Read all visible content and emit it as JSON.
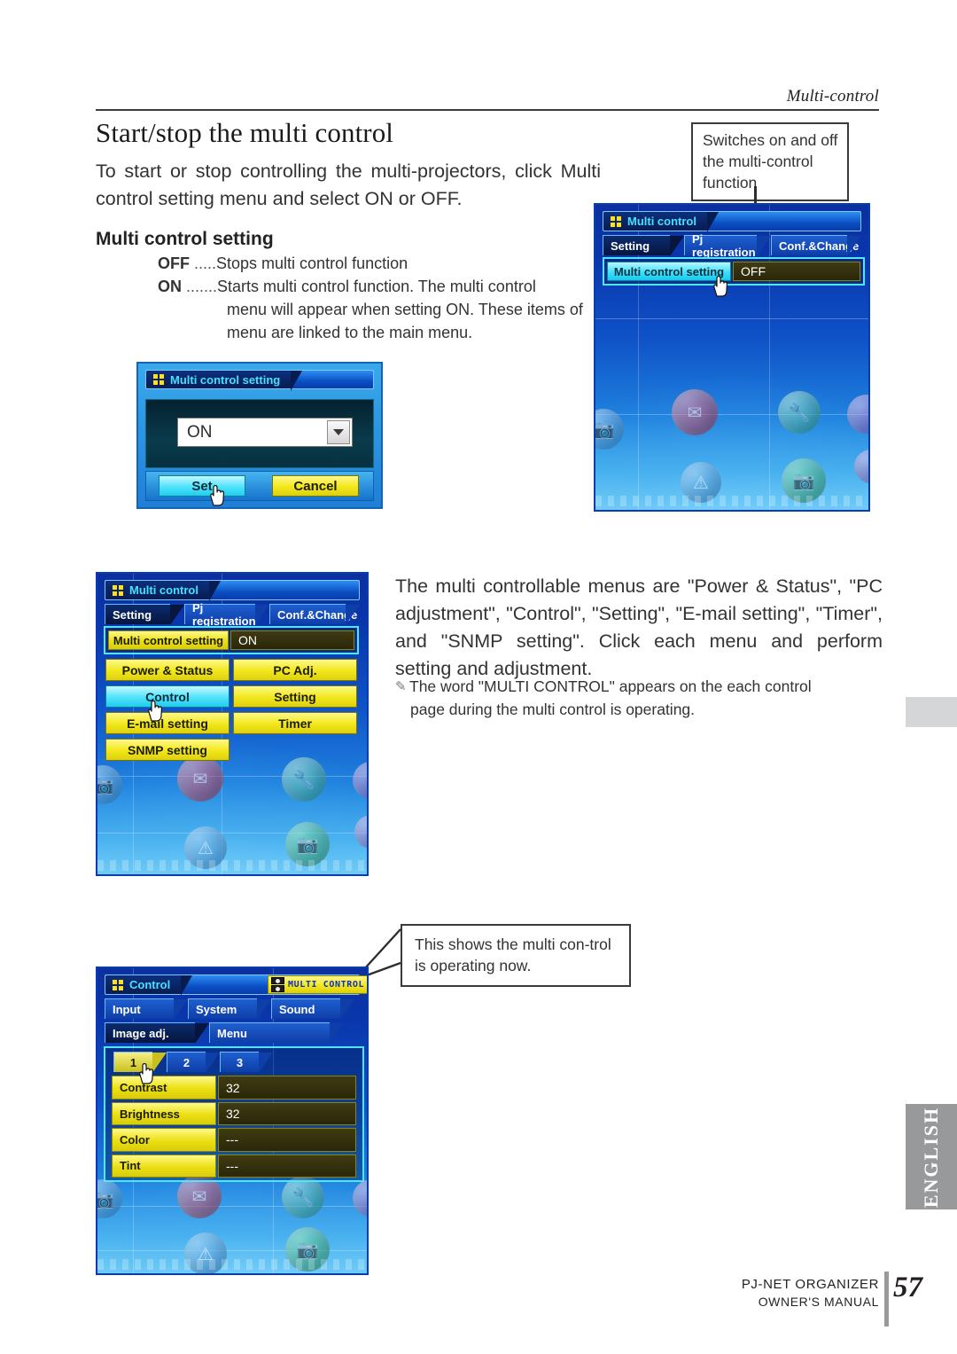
{
  "header": {
    "running_head": "Multi-control"
  },
  "section": {
    "title": "Start/stop the multi control",
    "lead": "To start or stop controlling the multi-projectors, click Multi control setting menu and select ON or OFF.",
    "subheading": "Multi control setting",
    "definitions": [
      {
        "term": "OFF",
        "dots": " .....",
        "desc": "Stops multi control function",
        "cont": ""
      },
      {
        "term": "ON",
        "dots": " .......",
        "desc": "Starts multi control function. The multi control",
        "cont": "menu will appear when setting ON. These items of menu are linked to the main menu."
      }
    ],
    "paragraph": "The multi controllable menus are \"Power & Status\", \"PC adjustment\", \"Control\", \"Setting\", \"E-mail setting\", \"Timer\", and \"SNMP setting\". Click each menu and perform setting and adjustment.",
    "note_icon": "pencil-icon",
    "note_line1": "The word \"MULTI CONTROL\" appears on the each control",
    "note_line2": "page during the multi control is operating."
  },
  "callouts": {
    "top": "Switches on and off the multi-control function",
    "bottom": "This shows the multi con-trol is operating now."
  },
  "screenshot_multicontrol_off": {
    "window_title": "Multi control",
    "tabs": [
      {
        "label": "Setting",
        "state": "active"
      },
      {
        "label": "Pj registration",
        "state": "inactive"
      },
      {
        "label": "Conf.&Change",
        "state": "inactive"
      }
    ],
    "setting_row": {
      "label": "Multi control setting",
      "value": "OFF"
    },
    "cursor": "hand-cursor"
  },
  "dialog_multicontrol_setting": {
    "window_title": "Multi control setting",
    "combo_value": "ON",
    "combo_icon": "chevron-down-icon",
    "set_label": "Set",
    "cancel_label": "Cancel",
    "cursor": "hand-cursor"
  },
  "screenshot_multicontrol_on": {
    "window_title": "Multi control",
    "tabs": [
      {
        "label": "Setting",
        "state": "active"
      },
      {
        "label": "Pj registration",
        "state": "inactive"
      },
      {
        "label": "Conf.&Change",
        "state": "inactive"
      }
    ],
    "setting_row": {
      "label": "Multi control setting",
      "value": "ON"
    },
    "menu_buttons": [
      {
        "label": "Power & Status",
        "state": "normal"
      },
      {
        "label": "PC Adj.",
        "state": "normal"
      },
      {
        "label": "Control",
        "state": "selected"
      },
      {
        "label": "Setting",
        "state": "normal"
      },
      {
        "label": "E-mail setting",
        "state": "normal"
      },
      {
        "label": "Timer",
        "state": "normal"
      },
      {
        "label": "SNMP setting",
        "state": "normal"
      }
    ],
    "cursor": "hand-cursor"
  },
  "screenshot_control": {
    "window_title": "Control",
    "badge_label": "MULTI CONTROL",
    "badge_icon": "projector-icon",
    "tabs_row1": [
      {
        "label": "Input",
        "state": "inactive"
      },
      {
        "label": "System",
        "state": "inactive"
      },
      {
        "label": "Sound",
        "state": "inactive"
      }
    ],
    "tabs_row2": [
      {
        "label": "Image adj.",
        "state": "active"
      },
      {
        "label": "Menu",
        "state": "inactive"
      }
    ],
    "page_tabs": [
      {
        "label": "1",
        "state": "active"
      },
      {
        "label": "2",
        "state": "inactive"
      },
      {
        "label": "3",
        "state": "inactive"
      }
    ],
    "rows": [
      {
        "label": "Contrast",
        "value": "32"
      },
      {
        "label": "Brightness",
        "value": "32"
      },
      {
        "label": "Color",
        "value": "---"
      },
      {
        "label": "Tint",
        "value": "---"
      }
    ],
    "cursor": "hand-cursor"
  },
  "sidebar": {
    "language_tab": "ENGLISH"
  },
  "footer": {
    "line1": "PJ-NET ORGANIZER",
    "line2": "OWNER'S MANUAL",
    "page_number": "57"
  },
  "colors": {
    "yellow_button": "#f0e41a",
    "cyan_selected": "#4fe3fb",
    "panel_blue": "#0f52c8",
    "title_cyan": "#48e0ff",
    "gray_tab": "#97999b"
  }
}
